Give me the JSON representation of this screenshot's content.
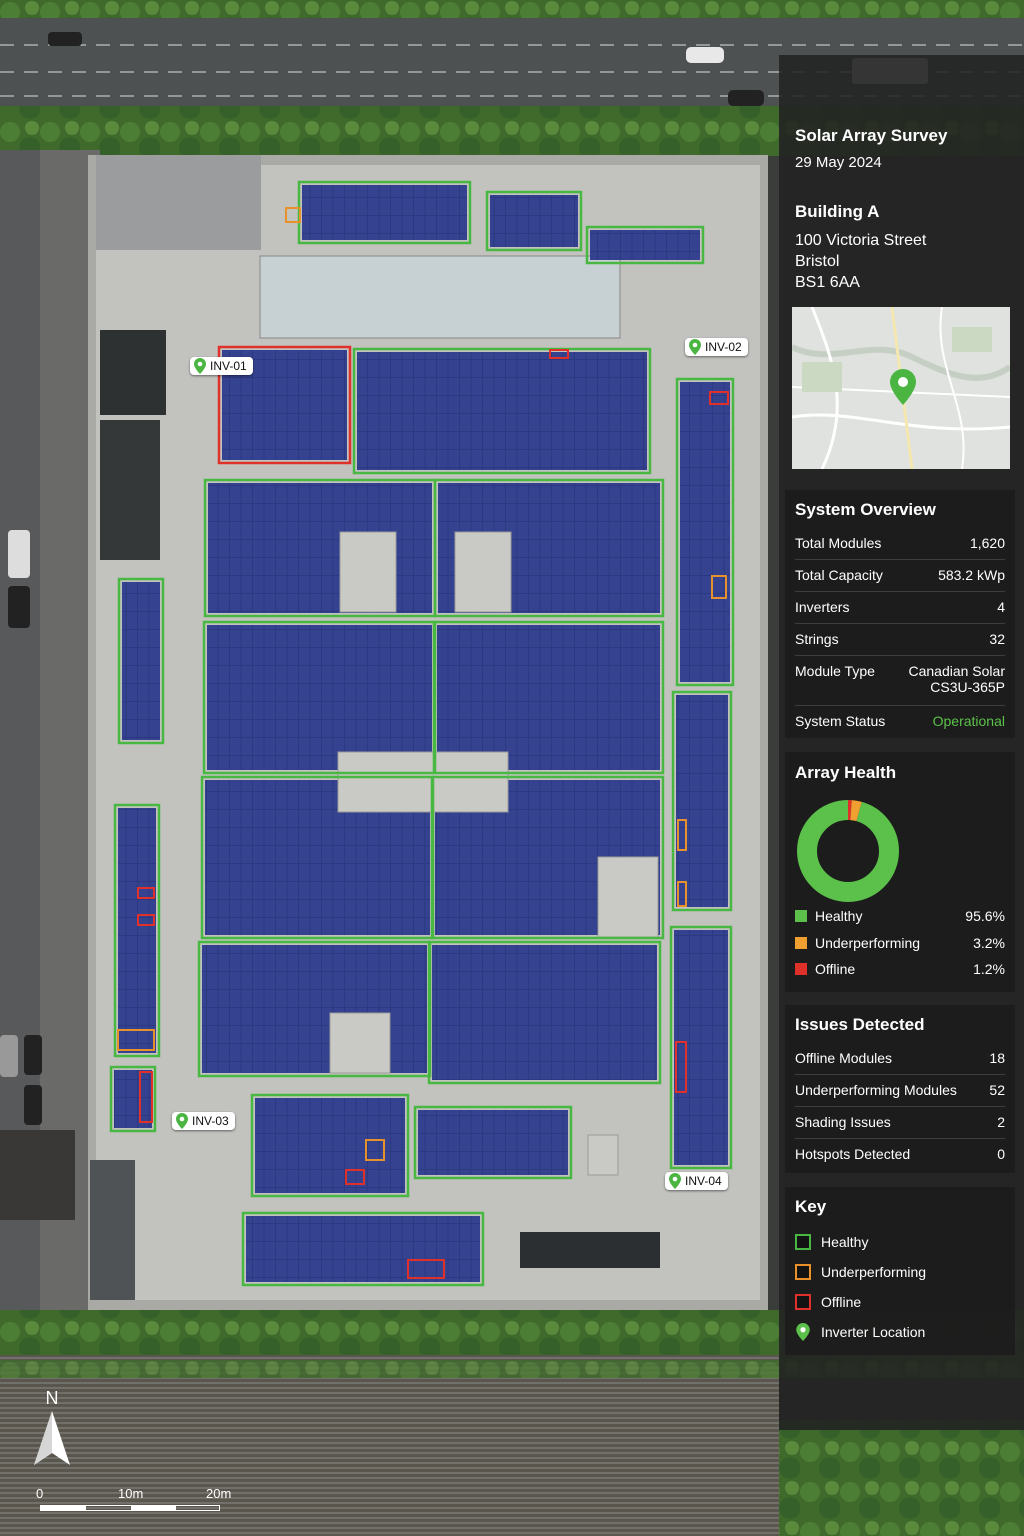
{
  "header": {
    "title": "Solar Array Survey",
    "date": "29 May 2024"
  },
  "building": {
    "name": "Building A",
    "address_lines": [
      "100 Victoria Street",
      "Bristol",
      "BS1 6AA"
    ]
  },
  "overview": {
    "title": "System Overview",
    "rows": [
      {
        "label": "Total Modules",
        "value": "1,620"
      },
      {
        "label": "Total Capacity",
        "value": "583.2 kWp"
      },
      {
        "label": "Inverters",
        "value": "4"
      },
      {
        "label": "Strings",
        "value": "32"
      },
      {
        "label": "Module Type",
        "value": "Canadian Solar\nCS3U-365P"
      },
      {
        "label": "System Status",
        "value": "Operational"
      }
    ]
  },
  "health": {
    "title": "Array Health",
    "items": [
      {
        "label": "Healthy",
        "value": "95.6%",
        "fraction": 0.956,
        "color": "#5cc14a"
      },
      {
        "label": "Underperforming",
        "value": "3.2%",
        "fraction": 0.032,
        "color": "#f0a030"
      },
      {
        "label": "Offline",
        "value": "1.2%",
        "fraction": 0.012,
        "color": "#e0302a"
      }
    ]
  },
  "issues": {
    "title": "Issues Detected",
    "rows": [
      {
        "label": "Offline Modules",
        "value": "18"
      },
      {
        "label": "Underperforming Modules",
        "value": "52"
      },
      {
        "label": "Shading Issues",
        "value": "2"
      },
      {
        "label": "Hotspots Detected",
        "value": "0"
      }
    ]
  },
  "key": {
    "title": "Key",
    "items": [
      {
        "label": "Healthy",
        "color": "#49b842"
      },
      {
        "label": "Underperforming",
        "color": "#e8902a"
      },
      {
        "label": "Offline",
        "color": "#e0302a"
      },
      {
        "label": "Inverter Location",
        "color": "#5cc14a"
      }
    ]
  },
  "inverters": [
    "INV-01",
    "INV-02",
    "INV-03",
    "INV-04"
  ],
  "north": "N",
  "scale": [
    "0",
    "10m",
    "20m"
  ],
  "colors": {
    "healthy": "#49b842",
    "under": "#e8902a",
    "offline": "#e0302a",
    "panel": "#2e3a7e"
  }
}
